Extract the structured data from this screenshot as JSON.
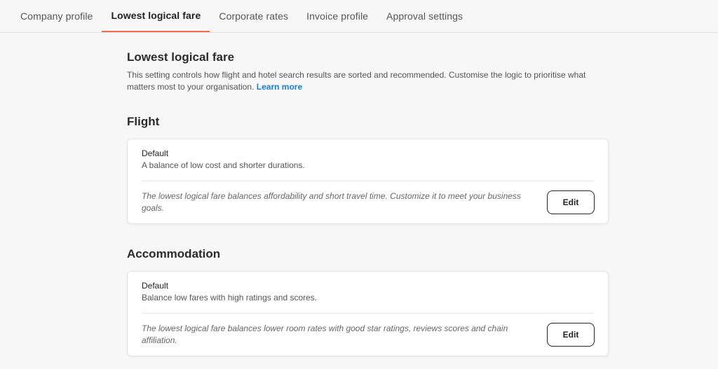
{
  "tabs": [
    {
      "label": "Company profile"
    },
    {
      "label": "Lowest logical fare"
    },
    {
      "label": "Corporate rates"
    },
    {
      "label": "Invoice profile"
    },
    {
      "label": "Approval settings"
    }
  ],
  "active_tab": "Lowest logical fare",
  "page": {
    "title": "Lowest logical fare",
    "description": "This setting controls how flight and hotel search results are sorted and recommended. Customise the logic to prioritise what matters most to your organisation.",
    "learn_more": "Learn more"
  },
  "sections": [
    {
      "title": "Flight",
      "card": {
        "heading": "Default",
        "subheading": "A balance of low cost and shorter durations.",
        "note": "The lowest logical fare balances affordability and short travel time. Customize it to meet your business goals.",
        "button": "Edit"
      }
    },
    {
      "title": "Accommodation",
      "card": {
        "heading": "Default",
        "subheading": "Balance low fares with high ratings and scores.",
        "note": "The lowest logical fare balances lower room rates with good star ratings, reviews scores and chain affiliation.",
        "button": "Edit"
      }
    }
  ],
  "colors": {
    "accent_underline": "#f26b4a",
    "link": "#1a7fd6",
    "background": "#f7f7f7"
  }
}
